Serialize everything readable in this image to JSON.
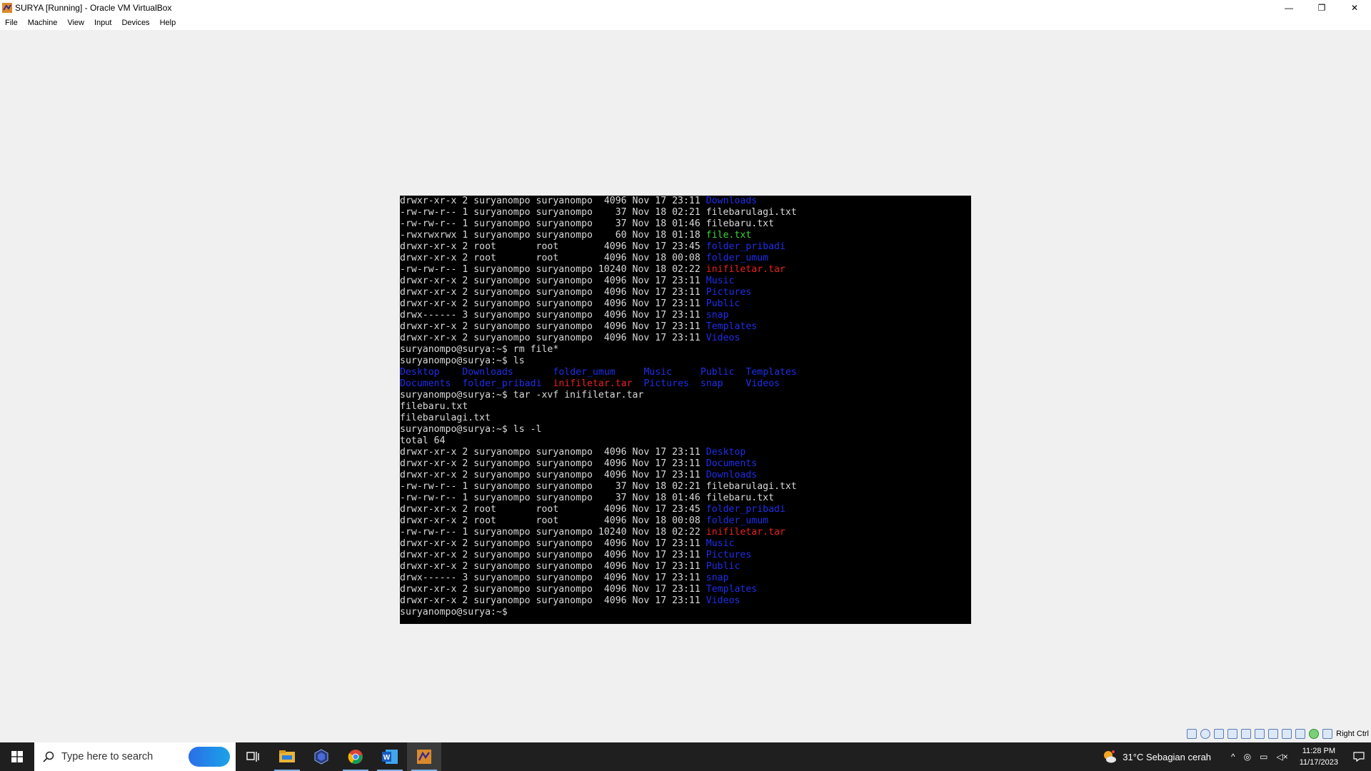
{
  "window": {
    "title": "SURYA [Running] - Oracle VM VirtualBox",
    "controls": {
      "minimize": "—",
      "restore": "❐",
      "close": "✕"
    }
  },
  "menu": [
    "File",
    "Machine",
    "View",
    "Input",
    "Devices",
    "Help"
  ],
  "terminal": {
    "lines": [
      [
        {
          "t": "drwxr-xr-x 2 suryanompo suryanompo  4096 Nov 17 23:11 "
        },
        {
          "t": "Downloads",
          "c": "dir"
        }
      ],
      [
        {
          "t": "-rw-rw-r-- 1 suryanompo suryanompo    37 Nov 18 02:21 filebarulagi.txt"
        }
      ],
      [
        {
          "t": "-rw-rw-r-- 1 suryanompo suryanompo    37 Nov 18 01:46 filebaru.txt"
        }
      ],
      [
        {
          "t": "-rwxrwxrwx 1 suryanompo suryanompo    60 Nov 18 01:18 "
        },
        {
          "t": "file.txt",
          "c": "grn"
        }
      ],
      [
        {
          "t": "drwxr-xr-x 2 root       root        4096 Nov 17 23:45 "
        },
        {
          "t": "folder_pribadi",
          "c": "dir"
        }
      ],
      [
        {
          "t": "drwxr-xr-x 2 root       root        4096 Nov 18 00:08 "
        },
        {
          "t": "folder_umum",
          "c": "dir"
        }
      ],
      [
        {
          "t": "-rw-rw-r-- 1 suryanompo suryanompo 10240 Nov 18 02:22 "
        },
        {
          "t": "inifiletar.tar",
          "c": "red"
        }
      ],
      [
        {
          "t": "drwxr-xr-x 2 suryanompo suryanompo  4096 Nov 17 23:11 "
        },
        {
          "t": "Music",
          "c": "dir"
        }
      ],
      [
        {
          "t": "drwxr-xr-x 2 suryanompo suryanompo  4096 Nov 17 23:11 "
        },
        {
          "t": "Pictures",
          "c": "dir"
        }
      ],
      [
        {
          "t": "drwxr-xr-x 2 suryanompo suryanompo  4096 Nov 17 23:11 "
        },
        {
          "t": "Public",
          "c": "dir"
        }
      ],
      [
        {
          "t": "drwx------ 3 suryanompo suryanompo  4096 Nov 17 23:11 "
        },
        {
          "t": "snap",
          "c": "dir"
        }
      ],
      [
        {
          "t": "drwxr-xr-x 2 suryanompo suryanompo  4096 Nov 17 23:11 "
        },
        {
          "t": "Templates",
          "c": "dir"
        }
      ],
      [
        {
          "t": "drwxr-xr-x 2 suryanompo suryanompo  4096 Nov 17 23:11 "
        },
        {
          "t": "Videos",
          "c": "dir"
        }
      ],
      [
        {
          "t": "suryanompo@surya:~$ rm file*"
        }
      ],
      [
        {
          "t": "suryanompo@surya:~$ ls"
        }
      ],
      [
        {
          "t": "Desktop",
          "c": "dir"
        },
        {
          "t": "    "
        },
        {
          "t": "Downloads",
          "c": "dir"
        },
        {
          "t": "       "
        },
        {
          "t": "folder_umum",
          "c": "dir"
        },
        {
          "t": "     "
        },
        {
          "t": "Music",
          "c": "dir"
        },
        {
          "t": "     "
        },
        {
          "t": "Public",
          "c": "dir"
        },
        {
          "t": "  "
        },
        {
          "t": "Templates",
          "c": "dir"
        }
      ],
      [
        {
          "t": "Documents",
          "c": "dir"
        },
        {
          "t": "  "
        },
        {
          "t": "folder_pribadi",
          "c": "dir"
        },
        {
          "t": "  "
        },
        {
          "t": "inifiletar.tar",
          "c": "red"
        },
        {
          "t": "  "
        },
        {
          "t": "Pictures",
          "c": "dir"
        },
        {
          "t": "  "
        },
        {
          "t": "snap",
          "c": "dir"
        },
        {
          "t": "    "
        },
        {
          "t": "Videos",
          "c": "dir"
        }
      ],
      [
        {
          "t": "suryanompo@surya:~$ tar -xvf inifiletar.tar"
        }
      ],
      [
        {
          "t": "filebaru.txt"
        }
      ],
      [
        {
          "t": "filebarulagi.txt"
        }
      ],
      [
        {
          "t": "suryanompo@surya:~$ ls -l"
        }
      ],
      [
        {
          "t": "total 64"
        }
      ],
      [
        {
          "t": "drwxr-xr-x 2 suryanompo suryanompo  4096 Nov 17 23:11 "
        },
        {
          "t": "Desktop",
          "c": "dir"
        }
      ],
      [
        {
          "t": "drwxr-xr-x 2 suryanompo suryanompo  4096 Nov 17 23:11 "
        },
        {
          "t": "Documents",
          "c": "dir"
        }
      ],
      [
        {
          "t": "drwxr-xr-x 2 suryanompo suryanompo  4096 Nov 17 23:11 "
        },
        {
          "t": "Downloads",
          "c": "dir"
        }
      ],
      [
        {
          "t": "-rw-rw-r-- 1 suryanompo suryanompo    37 Nov 18 02:21 filebarulagi.txt"
        }
      ],
      [
        {
          "t": "-rw-rw-r-- 1 suryanompo suryanompo    37 Nov 18 01:46 filebaru.txt"
        }
      ],
      [
        {
          "t": "drwxr-xr-x 2 root       root        4096 Nov 17 23:45 "
        },
        {
          "t": "folder_pribadi",
          "c": "dir"
        }
      ],
      [
        {
          "t": "drwxr-xr-x 2 root       root        4096 Nov 18 00:08 "
        },
        {
          "t": "folder_umum",
          "c": "dir"
        }
      ],
      [
        {
          "t": "-rw-rw-r-- 1 suryanompo suryanompo 10240 Nov 18 02:22 "
        },
        {
          "t": "inifiletar.tar",
          "c": "red"
        }
      ],
      [
        {
          "t": "drwxr-xr-x 2 suryanompo suryanompo  4096 Nov 17 23:11 "
        },
        {
          "t": "Music",
          "c": "dir"
        }
      ],
      [
        {
          "t": "drwxr-xr-x 2 suryanompo suryanompo  4096 Nov 17 23:11 "
        },
        {
          "t": "Pictures",
          "c": "dir"
        }
      ],
      [
        {
          "t": "drwxr-xr-x 2 suryanompo suryanompo  4096 Nov 17 23:11 "
        },
        {
          "t": "Public",
          "c": "dir"
        }
      ],
      [
        {
          "t": "drwx------ 3 suryanompo suryanompo  4096 Nov 17 23:11 "
        },
        {
          "t": "snap",
          "c": "dir"
        }
      ],
      [
        {
          "t": "drwxr-xr-x 2 suryanompo suryanompo  4096 Nov 17 23:11 "
        },
        {
          "t": "Templates",
          "c": "dir"
        }
      ],
      [
        {
          "t": "drwxr-xr-x 2 suryanompo suryanompo  4096 Nov 17 23:11 "
        },
        {
          "t": "Videos",
          "c": "dir"
        }
      ],
      [
        {
          "t": "suryanompo@surya:~$ "
        }
      ]
    ]
  },
  "vm_status": {
    "icons": [
      "hard-disk-icon",
      "optical-drive-icon",
      "audio-icon",
      "network-icon",
      "usb-icon",
      "shared-folders-icon",
      "display-icon",
      "video-capture-icon",
      "recording-icon",
      "guest-additions-icon",
      "mouse-integration-icon"
    ],
    "host_key": "Right Ctrl"
  },
  "taskbar": {
    "search_placeholder": "Type here to search",
    "apps": [
      "task-view",
      "file-explorer",
      "virtualbox",
      "chrome",
      "word",
      "virtualbox-vm"
    ],
    "weather": "31°C  Sebagian cerah",
    "time": "11:28 PM",
    "date": "11/17/2023"
  },
  "colors": {
    "dir": "#1f2ee8",
    "red": "#e82020",
    "grn": "#3ad83a",
    "text": "#d9d9d9"
  }
}
